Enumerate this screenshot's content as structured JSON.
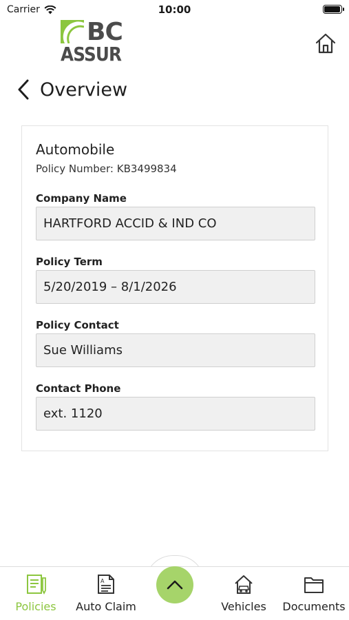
{
  "status_bar": {
    "carrier": "Carrier",
    "time": "10:00",
    "battery_level": 1.0
  },
  "header": {
    "logo_text_top": "BC",
    "logo_text_bottom": "ASSUR",
    "brand_color": "#8cc63f",
    "home_icon": "home-icon"
  },
  "nav": {
    "back_icon": "chevron-left-icon",
    "title": "Overview"
  },
  "policy": {
    "type": "Automobile",
    "number_text": "Policy Number: KB3499834",
    "fields": [
      {
        "label": "Company Name",
        "value": "HARTFORD ACCID & IND CO"
      },
      {
        "label": "Policy Term",
        "value": "5/20/2019 – 8/1/2026"
      },
      {
        "label": "Policy Contact",
        "value": "Sue Williams"
      },
      {
        "label": "Contact Phone",
        "value": "ext. 1120"
      }
    ]
  },
  "tab_bar": {
    "active_color": "#8cc63f",
    "tabs": [
      {
        "label": "Policies",
        "icon": "policies-icon",
        "active": true
      },
      {
        "label": "Auto Claim",
        "icon": "auto-claim-icon",
        "active": false
      },
      {
        "label": "Vehicles",
        "icon": "vehicles-icon",
        "active": false
      },
      {
        "label": "Documents",
        "icon": "documents-icon",
        "active": false
      }
    ],
    "center_button_icon": "chevron-up-icon",
    "center_button_color": "#a6d46a"
  }
}
